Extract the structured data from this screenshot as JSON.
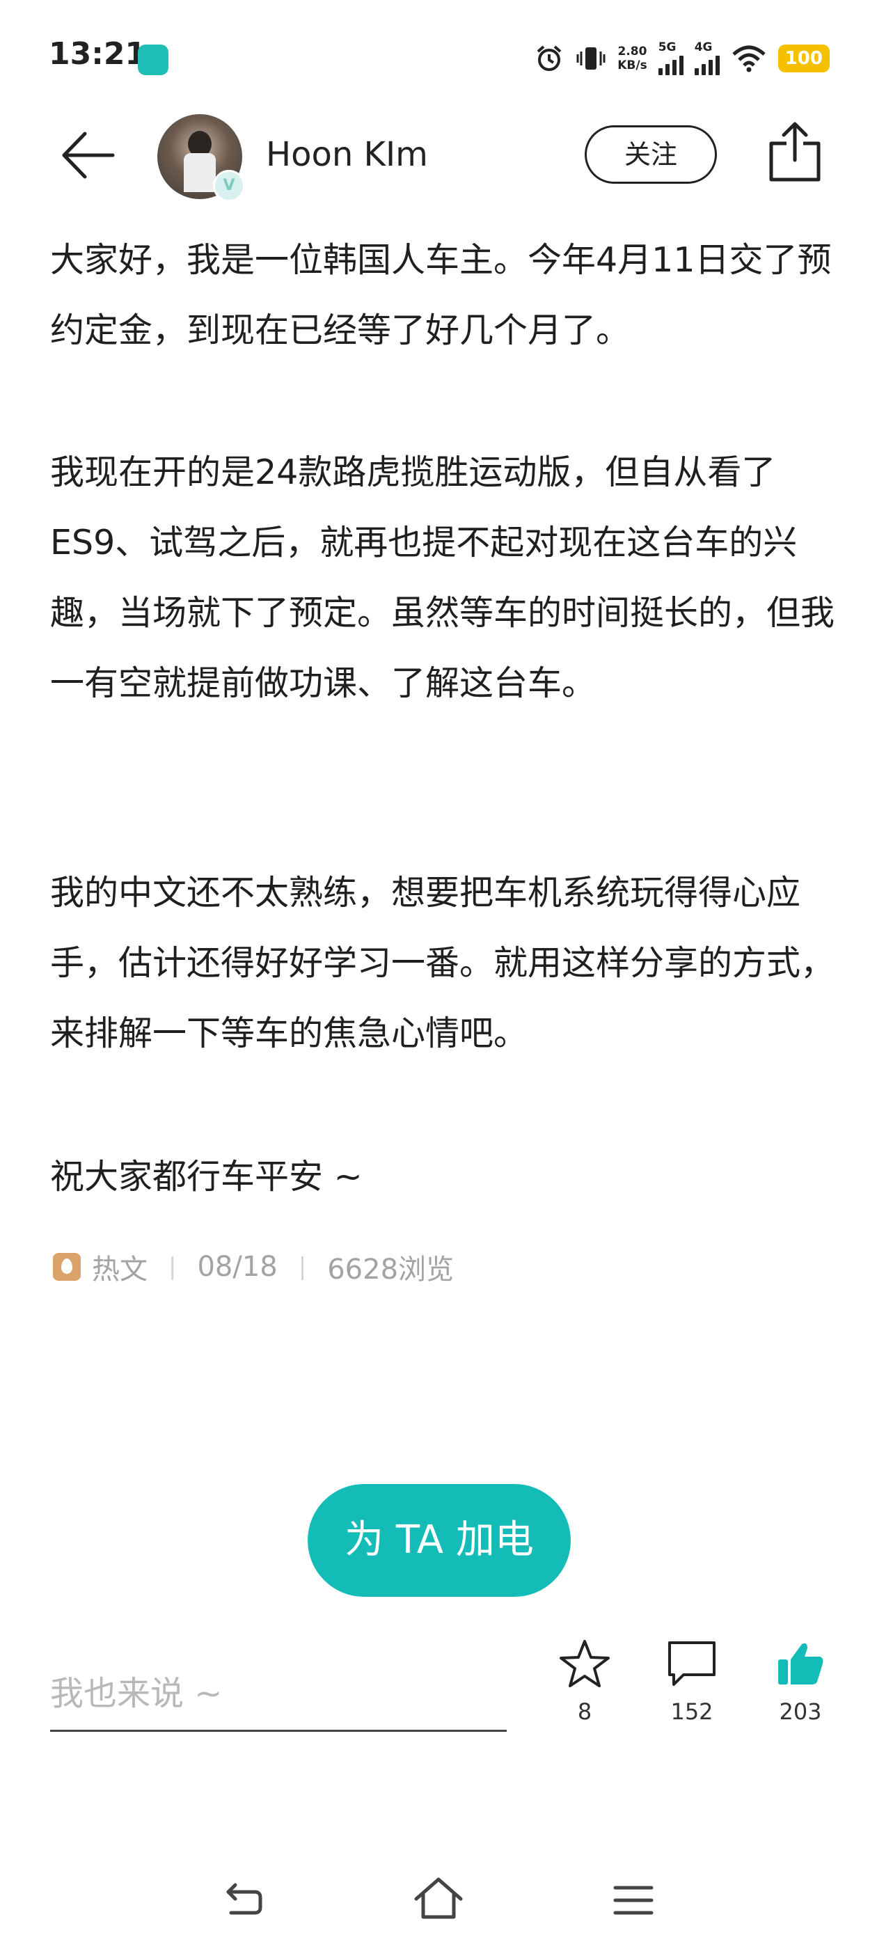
{
  "status_bar": {
    "time": "13:21",
    "speed_value": "2.80",
    "speed_unit": "KB/s",
    "net1": "5G",
    "net2": "4G",
    "battery": "100",
    "icons": [
      "alarm-icon",
      "vibrate-icon",
      "signal-icon",
      "wifi-icon"
    ]
  },
  "header": {
    "username": "Hoon KIm",
    "follow_label": "关注",
    "verified_mark": "V"
  },
  "post": {
    "paragraphs": [
      "大家好，我是一位韩国人车主。今年4月11日交了预约定金，到现在已经等了好几个月了。",
      "我现在开的是24款路虎揽胜运动版，但自从看了ES9、试驾之后，就再也提不起对现在这台车的兴趣，当场就下了预定。虽然等车的时间挺长的，但我一有空就提前做功课、了解这台车。",
      "我的中文还不太熟练，想要把车机系统玩得得心应手，估计还得好好学习一番。就用这样分享的方式，来排解一下等车的焦急心情吧。",
      "祝大家都行车平安 ~"
    ],
    "tag": "热文",
    "date": "08/18",
    "views": "6628浏览"
  },
  "charge_button": "为 TA 加电",
  "comment": {
    "placeholder": "我也来说 ~"
  },
  "actions": {
    "favorites": "8",
    "comments": "152",
    "likes": "203"
  },
  "colors": {
    "accent": "#13bcb6",
    "battery": "#f5c000",
    "meta_text": "#a3a3a3",
    "tag_icon": "#d9a36a"
  }
}
